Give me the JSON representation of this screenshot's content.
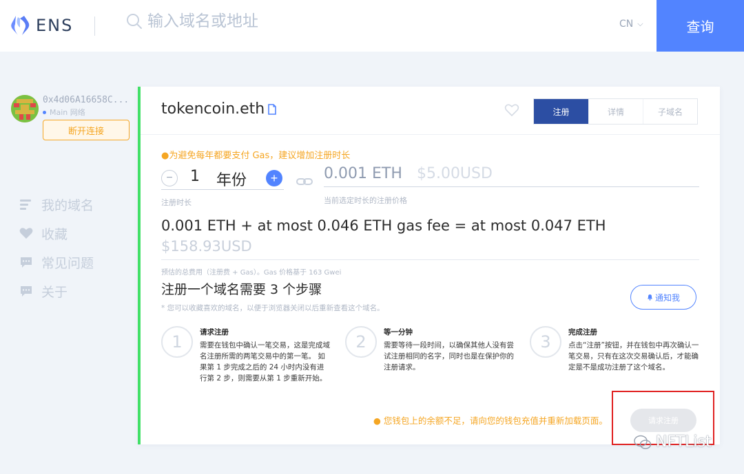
{
  "header": {
    "logo_text": "ENS",
    "search_placeholder": "输入域名或地址",
    "lang": "CN",
    "query_label": "查询"
  },
  "account": {
    "address": "0x4d06A16658C...",
    "network": "Main 网络",
    "disconnect_label": "断开连接"
  },
  "nav": {
    "items": [
      {
        "label": "我的域名",
        "icon": "list-icon"
      },
      {
        "label": "收藏",
        "icon": "heart-icon"
      },
      {
        "label": "常见问题",
        "icon": "chat-icon"
      },
      {
        "label": "关于",
        "icon": "chat-icon"
      }
    ]
  },
  "card": {
    "domain": "tokencoin.eth",
    "tabs": [
      {
        "label": "注册",
        "active": true
      },
      {
        "label": "详情",
        "active": false
      },
      {
        "label": "子域名",
        "active": false
      }
    ],
    "gas_warning": "●为避免每年都要支付 Gas，建议增加注册时长",
    "years_value": "1",
    "years_unit": "年份",
    "minus_label": "−",
    "plus_label": "+",
    "years_label": "注册时长",
    "price_eth": "0.001 ETH",
    "price_usd": "$5.00USD",
    "price_label": "当前选定时长的注册价格",
    "total_text": "0.001 ETH + at most 0.046 ETH gas fee = at most 0.047 ETH",
    "total_usd": "$158.93USD",
    "total_label": "预估的总费用（注册费 + Gas）。Gas 价格基于 163 Gwei",
    "steps_title": "注册一个域名需要 3 个步骤",
    "steps_note": "* 您可以收藏喜欢的域名，以便于浏览器关闭以后重新查看这个域名。",
    "notify_label": "通知我",
    "steps": [
      {
        "num": "1",
        "title": "请求注册",
        "desc": "需要在钱包中确认一笔交易，这是完成域名注册所需的两笔交易中的第一笔。 如果第 1 步完成之后的 24 小时内没有进行第 2 步，则需要从第 1 步重新开始。"
      },
      {
        "num": "2",
        "title": "等一分钟",
        "desc": "需要等待一段时间，以确保其他人没有尝试注册相同的名字，同时也是在保护你的注册请求。"
      },
      {
        "num": "3",
        "title": "完成注册",
        "desc": "点击“注册”按钮，并在钱包中再次确认一笔交易，只有在这次交易确认后，才能确定是不是成功注册了这个域名。"
      }
    ],
    "balance_warning": "● 您钱包上的余额不足，请向您的钱包充值并重新加载页面。",
    "register_label": "请求注册"
  },
  "watermark": "NFTList",
  "colors": {
    "accent": "#5284ff",
    "tab_active": "#2c4ea3",
    "warning": "#f5a623",
    "card_border": "#42e068",
    "highlight": "#e02020"
  }
}
